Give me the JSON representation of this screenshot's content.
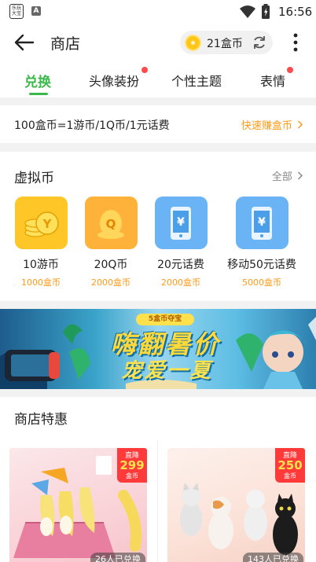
{
  "status_bar": {
    "app_icon_text": "乐玩大宝",
    "notification_letter": "A",
    "time": "16:56"
  },
  "app_bar": {
    "title": "商店",
    "coin_balance": "21盒币"
  },
  "tabs": [
    {
      "label": "兑换",
      "active": true,
      "dot": false
    },
    {
      "label": "头像装扮",
      "active": false,
      "dot": true
    },
    {
      "label": "个性主题",
      "active": false,
      "dot": false
    },
    {
      "label": "表情",
      "active": false,
      "dot": true
    }
  ],
  "rate": {
    "text": "100盒币=1游币/1Q币/1元话费",
    "earn_link": "快速赚盒币"
  },
  "virtual_currency": {
    "title": "虚拟币",
    "all_link": "全部",
    "items": [
      {
        "name": "10游币",
        "price": "1000盒币",
        "icon": "game-coin-icon",
        "color": "#ffc627"
      },
      {
        "name": "20Q币",
        "price": "2000盒币",
        "icon": "qq-coin-icon",
        "color": "#ffb23a"
      },
      {
        "name": "20元话费",
        "price": "2000盒币",
        "icon": "phone-credit-icon",
        "color": "#6ab4f5"
      },
      {
        "name": "移动50元话费",
        "price": "5000盒币",
        "icon": "mobile-credit-icon",
        "color": "#6ab4f5"
      }
    ]
  },
  "banner": {
    "tag": "5盒币夺宝",
    "line1": "嗨翻暑价",
    "line2": "宠爱一夏"
  },
  "offers": {
    "title": "商店特惠",
    "items": [
      {
        "tag_label": "直降",
        "tag_value": "299",
        "tag_unit": "盒币",
        "redeemed": "26人已兑换",
        "image": "banana-toy-image"
      },
      {
        "tag_label": "直降",
        "tag_value": "250",
        "tag_unit": "盒币",
        "redeemed": "143人已兑换",
        "image": "cat-figurines-image"
      }
    ]
  },
  "colors": {
    "accent_green": "#3cb84a",
    "accent_orange": "#ff9a18",
    "badge_red": "#ff4b4b"
  }
}
